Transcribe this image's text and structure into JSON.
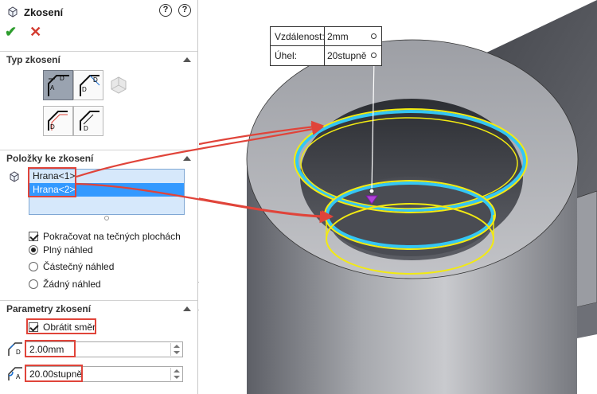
{
  "panel": {
    "title": "Zkosení",
    "help_glyph": "?",
    "ok_glyph": "✔",
    "cancel_glyph": "✕"
  },
  "chamfer_type": {
    "heading": "Typ zkosení"
  },
  "items": {
    "heading": "Položky ke zkosení",
    "list": [
      "Hrana<1>",
      "Hrana<2>"
    ],
    "continue_tangent": "Pokračovat na tečných plochách",
    "preview_full": "Plný náhled",
    "preview_partial": "Částečný náhled",
    "preview_none": "Žádný náhled"
  },
  "params": {
    "heading": "Parametry zkosení",
    "reverse": "Obrátit směr",
    "distance_value": "2.00mm",
    "angle_value": "20.00stupně"
  },
  "callout": {
    "distance_label": "Vzdálenost:",
    "distance_value": "2mm",
    "angle_label": "Úhel:",
    "angle_value": "20stupně"
  },
  "colors": {
    "accent_red": "#e0443a",
    "selection_blue": "#3399ff",
    "edge_yellow": "#f2ea12",
    "edge_cyan": "#34c6f4"
  }
}
